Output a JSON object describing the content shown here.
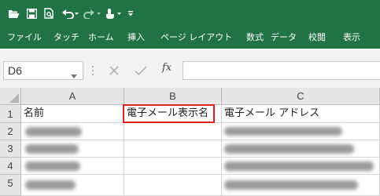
{
  "quick_access": {
    "icons": [
      "folder-open-icon",
      "save-icon",
      "print-preview-icon",
      "undo-icon",
      "redo-icon",
      "touch-mode-icon",
      "customize-icon"
    ]
  },
  "ribbon": {
    "tabs": [
      {
        "label": "ファイル"
      },
      {
        "label": "タッチ"
      },
      {
        "label": "ホーム"
      },
      {
        "label": "挿入"
      },
      {
        "label": "ページ レイアウト"
      },
      {
        "label": "数式"
      },
      {
        "label": "データ"
      },
      {
        "label": "校閲"
      },
      {
        "label": "表示"
      }
    ]
  },
  "formula_bar": {
    "name_box": "D6",
    "fx_label": "fx",
    "formula": ""
  },
  "sheet": {
    "columns": [
      "A",
      "B",
      "C"
    ],
    "rows": [
      "1",
      "2",
      "3",
      "4",
      "5"
    ],
    "header_row": {
      "a": "名前",
      "b": "電子メール表示名",
      "c": "電子メール アドレス"
    }
  },
  "colors": {
    "ribbon_green": "#217346",
    "highlight_red": "#e02020"
  }
}
